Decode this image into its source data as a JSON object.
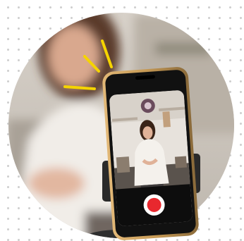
{
  "scene": {
    "subject": "woman-recording-video",
    "icons": [
      "attention-burst-icon",
      "record-button-icon"
    ],
    "colors": {
      "background": "#ffffff",
      "dots": "#cfcfcf",
      "burst": "#f5d400",
      "phone_frame": "#c79a55",
      "record": "#e8282e"
    }
  }
}
